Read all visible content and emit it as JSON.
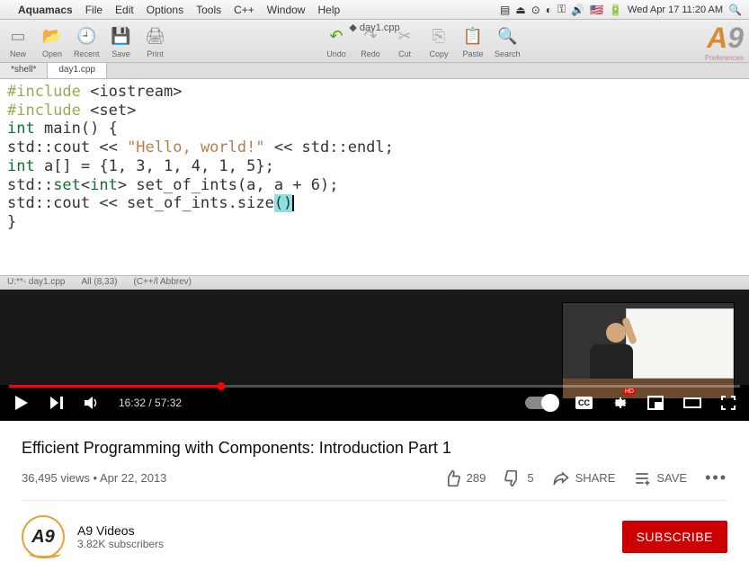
{
  "mac": {
    "app": "Aquamacs",
    "menus": [
      "File",
      "Edit",
      "Options",
      "Tools",
      "C++",
      "Window",
      "Help"
    ],
    "clock": "Wed Apr 17  11:20 AM",
    "window_title": "day1.cpp"
  },
  "toolbar": {
    "left": [
      {
        "name": "new",
        "label": "New",
        "icon": "▭"
      },
      {
        "name": "open",
        "label": "Open",
        "icon": "📂"
      },
      {
        "name": "recent",
        "label": "Recent",
        "icon": "🕘"
      },
      {
        "name": "save",
        "label": "Save",
        "icon": "💾"
      },
      {
        "name": "print",
        "label": "Print",
        "icon": "🖨"
      }
    ],
    "center": [
      {
        "name": "undo",
        "label": "Undo",
        "icon": "↶",
        "cls": "green"
      },
      {
        "name": "redo",
        "label": "Redo",
        "icon": "↷",
        "cls": "grey"
      },
      {
        "name": "cut",
        "label": "Cut",
        "icon": "✂",
        "cls": "grey"
      },
      {
        "name": "copy",
        "label": "Copy",
        "icon": "⎘",
        "cls": "grey"
      },
      {
        "name": "paste",
        "label": "Paste",
        "icon": "📋",
        "cls": "orange"
      },
      {
        "name": "search",
        "label": "Search",
        "icon": "🔍",
        "cls": "blue"
      }
    ],
    "logo_a": "A",
    "logo_9": "9",
    "pref": "Preferences"
  },
  "tabs": [
    {
      "label": "*shell*",
      "active": false
    },
    {
      "label": "day1.cpp",
      "active": true
    }
  ],
  "code": {
    "l1a": "#include",
    "l1b": " <iostream>",
    "l2a": "#include",
    "l2b": " <set>",
    "l3": "",
    "l4a": "int",
    "l4b": " main() {",
    "l5a": "  std::cout << ",
    "l5b": "\"Hello, world!\"",
    "l5c": " << std::endl;",
    "l6a": "  ",
    "l6b": "int",
    "l6c": " a[] = {1, 3, 1, 4, 1, 5};",
    "l7a": "  std::",
    "l7b": "set",
    "l7c": "<",
    "l7d": "int",
    "l7e": "> set_of_ints(a, a + 6);",
    "l8a": "  std::cout << set_of_ints.size",
    "l8b": "()",
    "l9": "}"
  },
  "statusbar": {
    "buf": "U:**-  day1.cpp",
    "pos": "All (8,33)",
    "mode": "(C++/l Abbrev)"
  },
  "player": {
    "current": "16:32",
    "total": "57:32",
    "cc": "CC",
    "hd": "HD"
  },
  "video": {
    "title": "Efficient Programming with Components: Introduction Part 1",
    "views": "36,495 views",
    "date": "Apr 22, 2013",
    "likes": "289",
    "dislikes": "5",
    "share": "SHARE",
    "save": "SAVE"
  },
  "channel": {
    "name": "A9 Videos",
    "subs": "3.82K subscribers",
    "avatar_text": "A9",
    "subscribe": "SUBSCRIBE"
  }
}
